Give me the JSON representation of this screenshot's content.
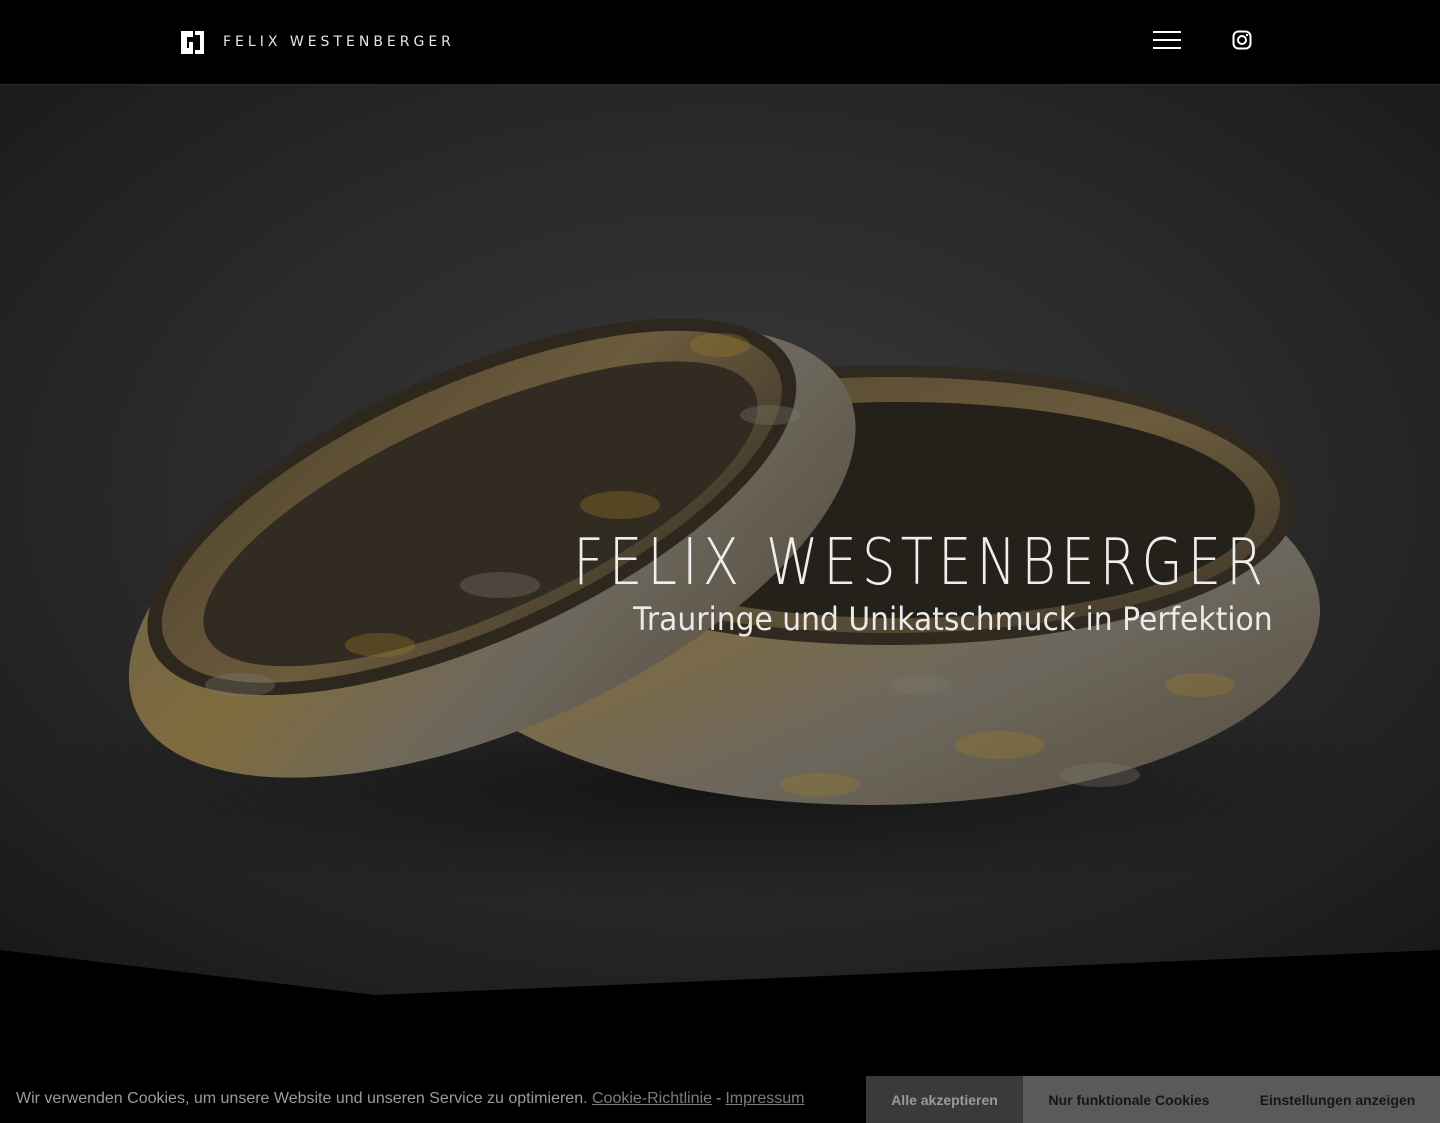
{
  "header": {
    "brand_name": "FELIX WESTENBERGER"
  },
  "hero": {
    "title": "FELIX WESTENBERGER",
    "subtitle": "Trauringe und Unikatschmuck in Perfektion"
  },
  "cookie_bar": {
    "message": "Wir verwenden Cookies, um unsere Website und unseren Service zu optimieren.",
    "policy_link": "Cookie-Richtlinie",
    "separator": "-",
    "imprint_link": "Impressum",
    "accept_all_label": "Alle akzeptieren",
    "functional_only_label": "Nur funktionale Cookies",
    "settings_label": "Einstellungen anzeigen"
  },
  "icons": {
    "logo": "felix-westenberger-logo-icon",
    "menu": "hamburger-menu-icon",
    "social": "instagram-icon"
  },
  "colors": {
    "background": "#000000",
    "text_light": "#eeeeee",
    "cookie_button_dark": "#3a3a3a",
    "cookie_button_gray": "#5a5a5a"
  }
}
